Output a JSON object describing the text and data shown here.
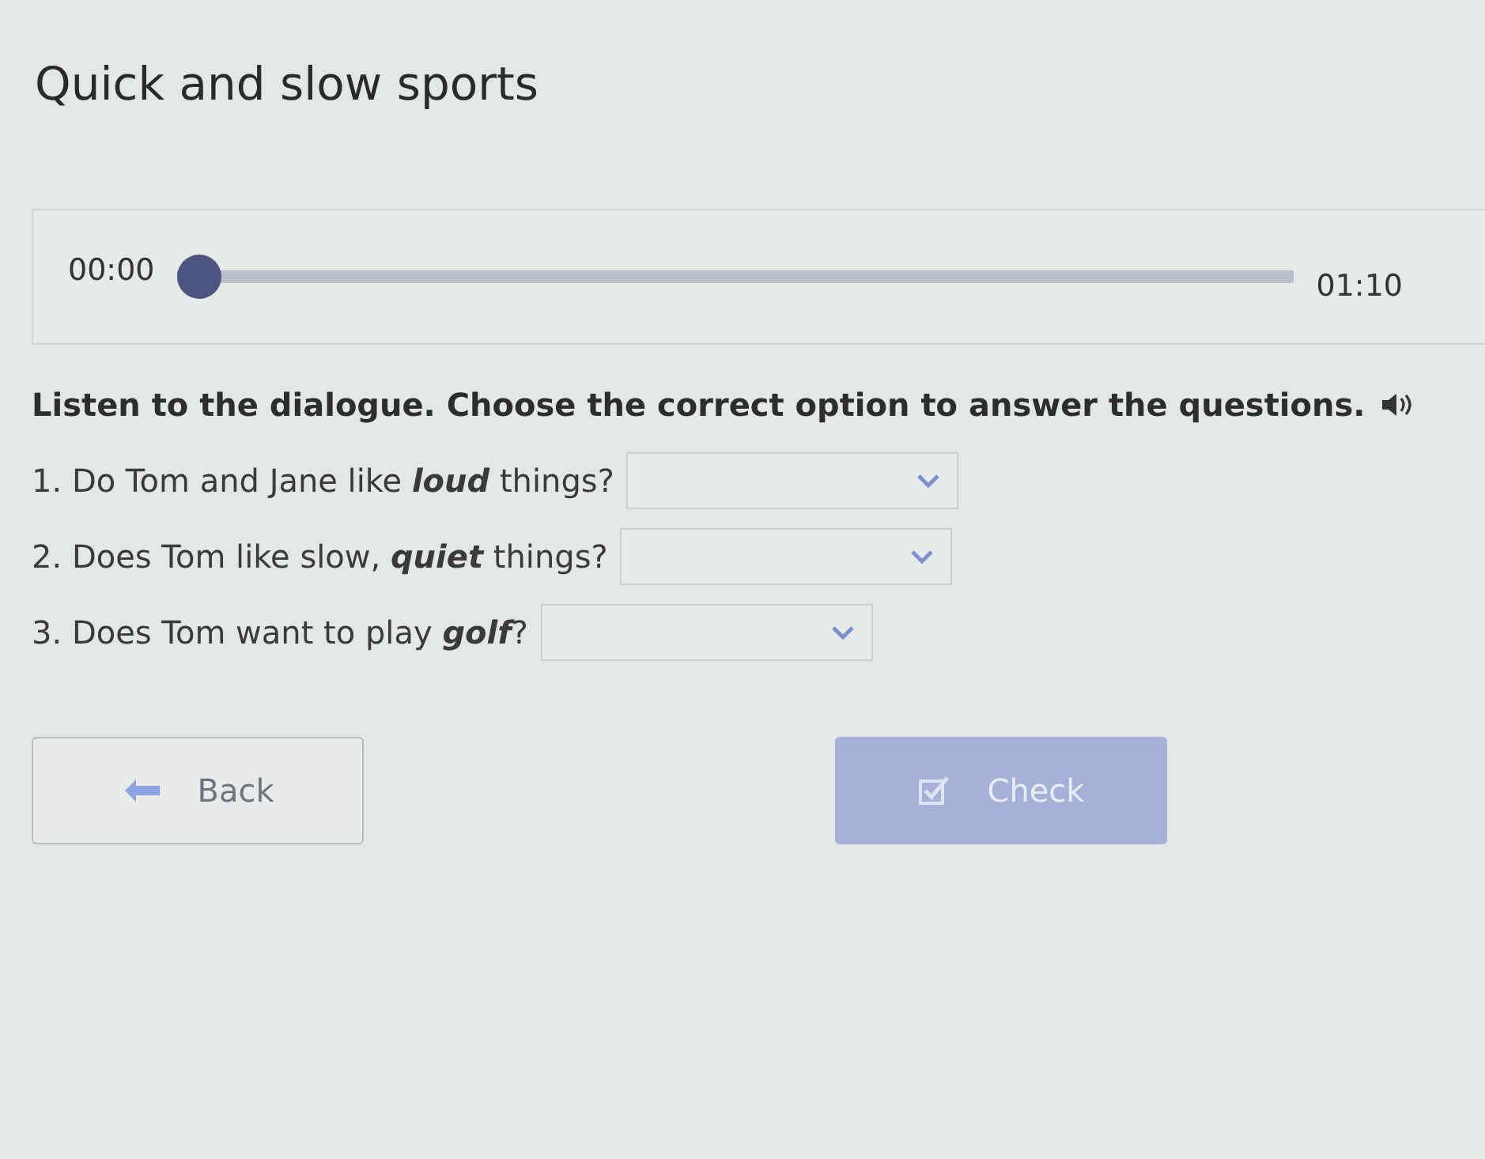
{
  "title": "Quick and slow sports",
  "player": {
    "current": "00:00",
    "duration": "01:10",
    "level": 0
  },
  "instruction": "Listen to the dialogue. Choose the correct option to answer the questions.",
  "questions": [
    {
      "text": "1. Do Tom and Jane like **loud** things?"
    },
    {
      "text": "2. Does Tom like slow, **quiet** things?"
    },
    {
      "text": "3. Does Tom want to play **golf**?"
    }
  ],
  "buttons": [
    {
      "kind": "back",
      "label": "Back",
      "disabled": false
    },
    {
      "kind": "check",
      "label": "Check",
      "disabled": true
    }
  ]
}
